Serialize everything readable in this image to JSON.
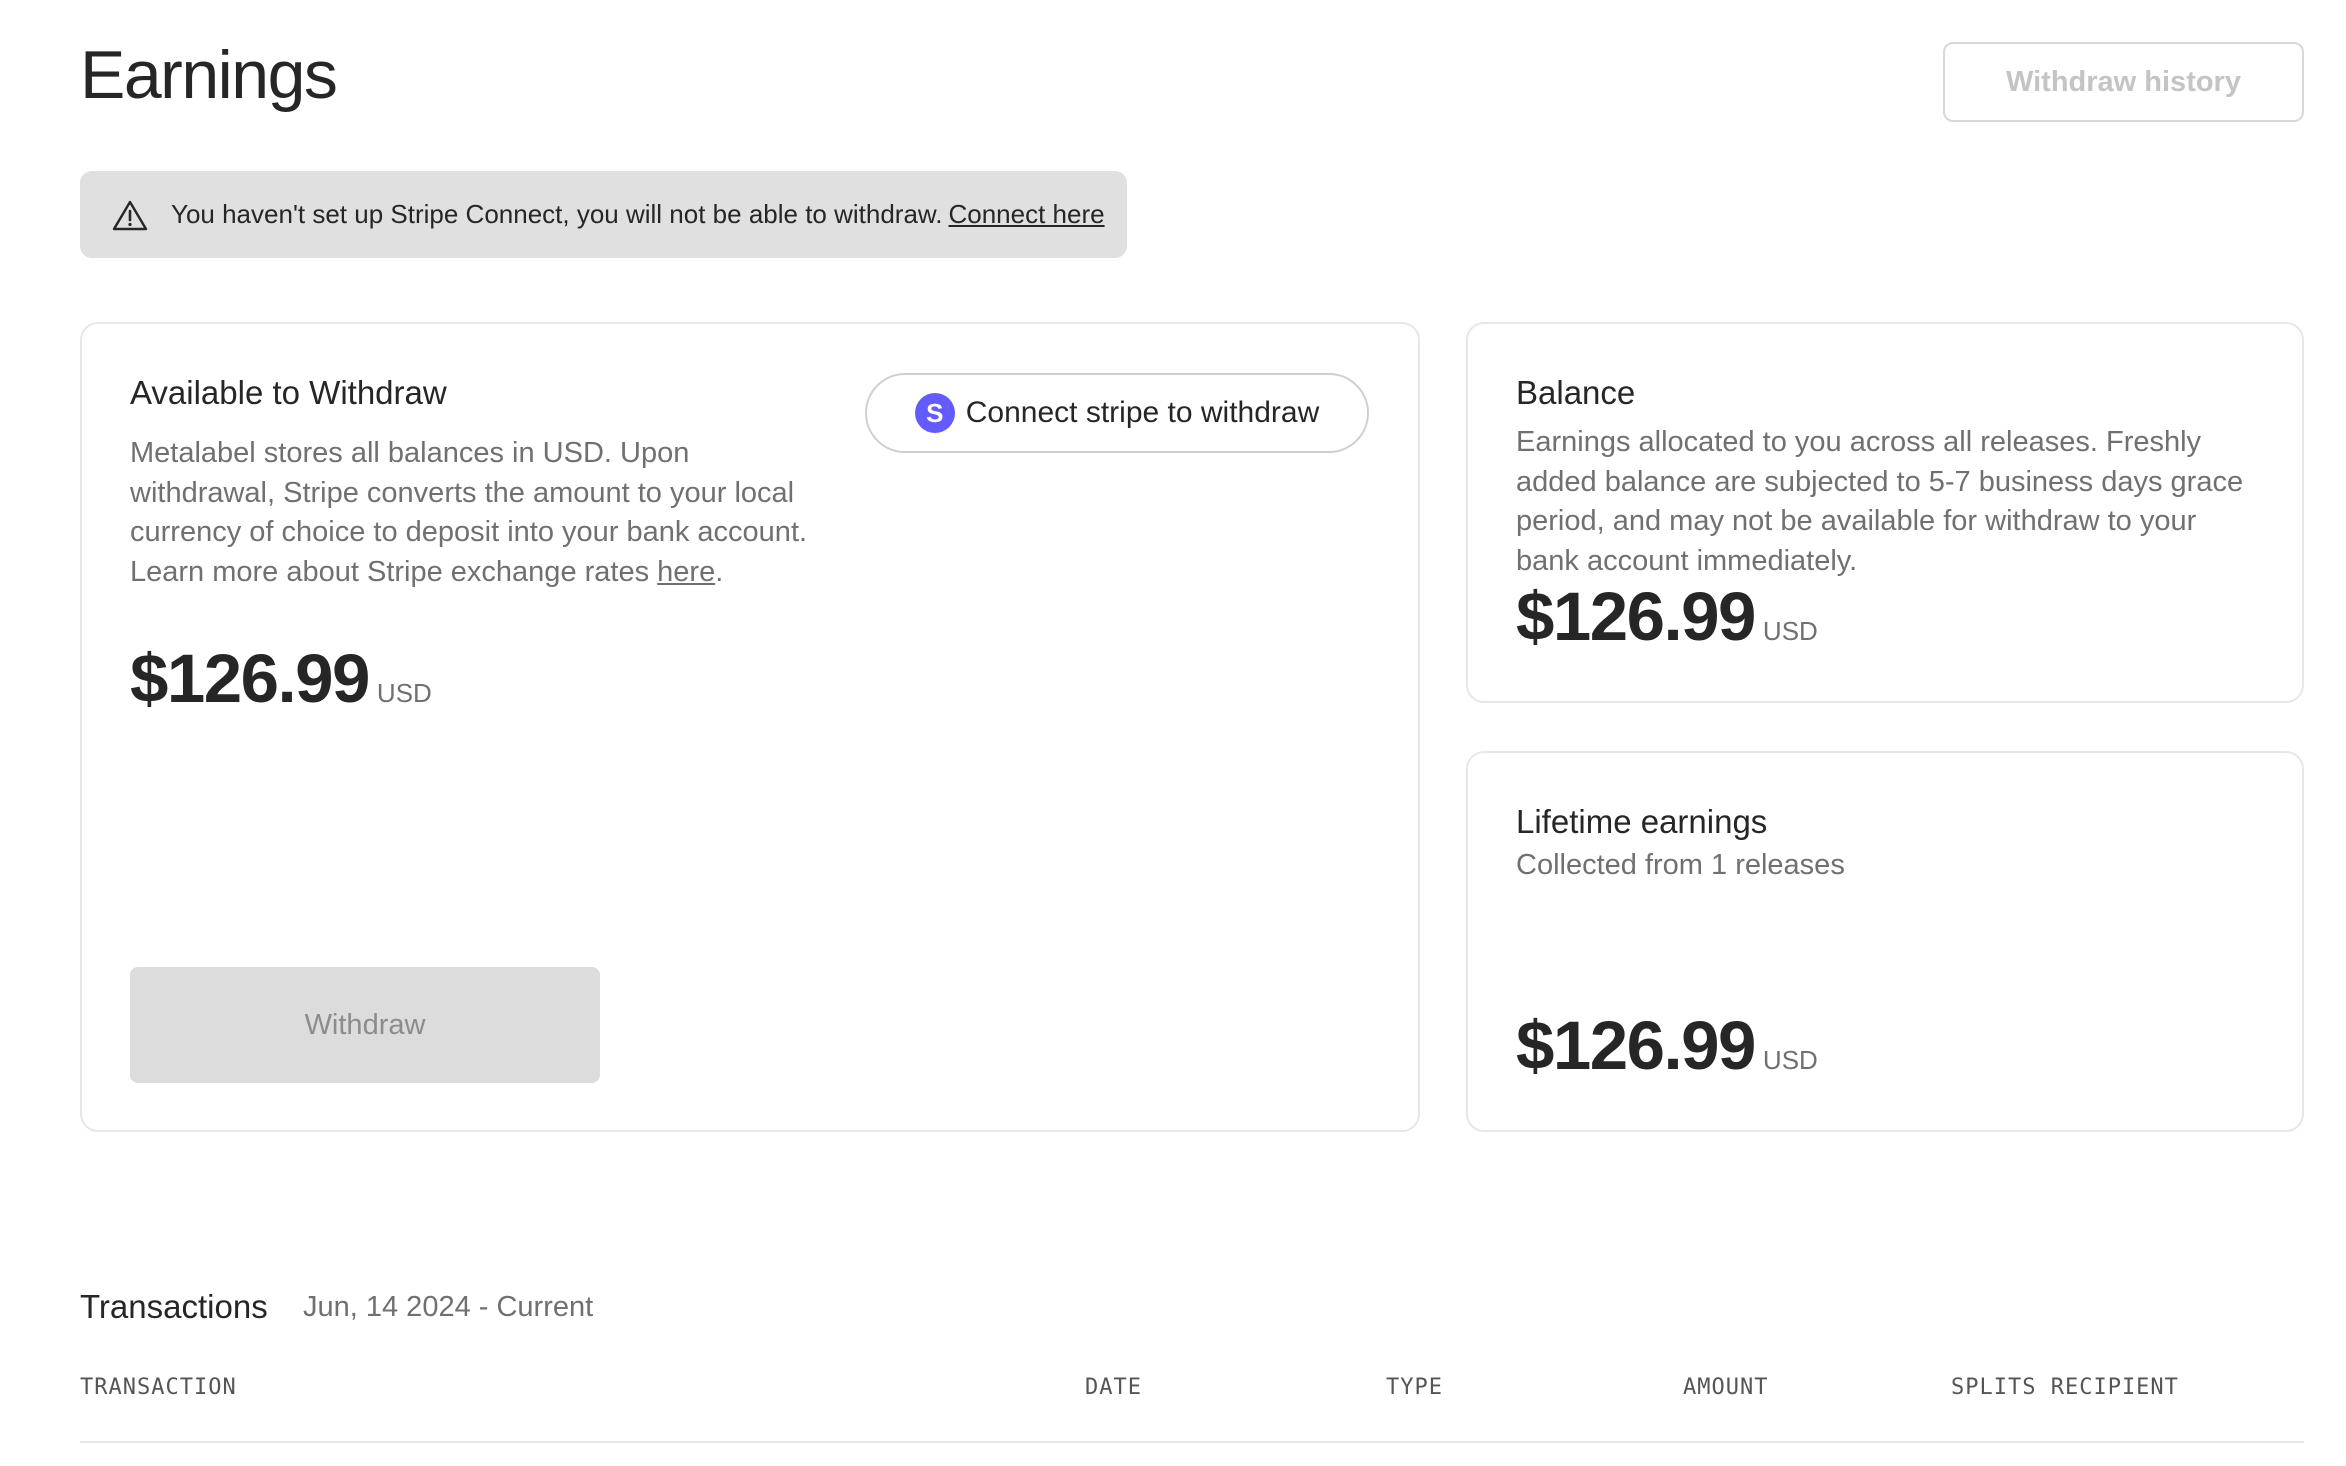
{
  "header": {
    "title": "Earnings",
    "withdraw_history_label": "Withdraw history"
  },
  "alert": {
    "message": "You haven't set up Stripe Connect, you will not be able to withdraw.",
    "link_label": "Connect here",
    "icon": "warning-triangle-icon"
  },
  "available": {
    "title": "Available to Withdraw",
    "description": "Metalabel stores all balances in USD. Upon withdrawal, Stripe converts the amount to your local currency of choice to deposit into your bank account. Learn more about Stripe exchange rates",
    "link_label": "here",
    "amount": "$126.99",
    "currency": "USD",
    "connect_button_label": "Connect stripe to withdraw",
    "stripe_logo_letter": "S",
    "withdraw_button_label": "Withdraw"
  },
  "balance": {
    "title": "Balance",
    "description": "Earnings allocated to you across all releases. Freshly added balance are subjected to 5-7 business days grace period, and may not be available for withdraw to your bank account immediately.",
    "amount": "$126.99",
    "currency": "USD"
  },
  "lifetime": {
    "title": "Lifetime earnings",
    "subtitle": "Collected from 1 releases",
    "amount": "$126.99",
    "currency": "USD"
  },
  "transactions": {
    "title": "Transactions",
    "range": "Jun, 14 2024 - Current",
    "columns": [
      "TRANSACTION",
      "DATE",
      "TYPE",
      "AMOUNT",
      "SPLITS RECIPIENT"
    ]
  },
  "colors": {
    "stripe_brand": "#635bff",
    "alert_bg": "#e0e0e0",
    "muted_text": "#707070"
  }
}
